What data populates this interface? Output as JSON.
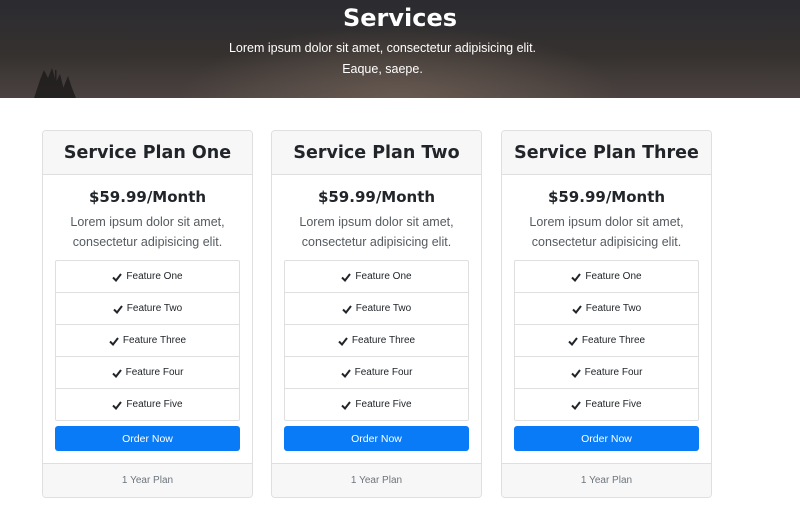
{
  "hero": {
    "title": "Services",
    "text": "Lorem ipsum dolor sit amet, consectetur adipisicing elit. Eaque, saepe."
  },
  "colors": {
    "button": "#0a7bf7",
    "card_header_bg": "#f7f7f7",
    "border": "#dfdfdf"
  },
  "icons": {
    "feature_check": "check-icon"
  },
  "plans": [
    {
      "title": "Service Plan One",
      "price": "$59.99/Month",
      "description": "Lorem ipsum dolor sit amet, consectetur adipisicing elit.",
      "features": [
        "Feature One",
        "Feature Two",
        "Feature Three",
        "Feature Four",
        "Feature Five"
      ],
      "button": "Order Now",
      "footer": "1 Year Plan"
    },
    {
      "title": "Service Plan Two",
      "price": "$59.99/Month",
      "description": "Lorem ipsum dolor sit amet, consectetur adipisicing elit.",
      "features": [
        "Feature One",
        "Feature Two",
        "Feature Three",
        "Feature Four",
        "Feature Five"
      ],
      "button": "Order Now",
      "footer": "1 Year Plan"
    },
    {
      "title": "Service Plan Three",
      "price": "$59.99/Month",
      "description": "Lorem ipsum dolor sit amet, consectetur adipisicing elit.",
      "features": [
        "Feature One",
        "Feature Two",
        "Feature Three",
        "Feature Four",
        "Feature Five"
      ],
      "button": "Order Now",
      "footer": "1 Year Plan"
    }
  ]
}
